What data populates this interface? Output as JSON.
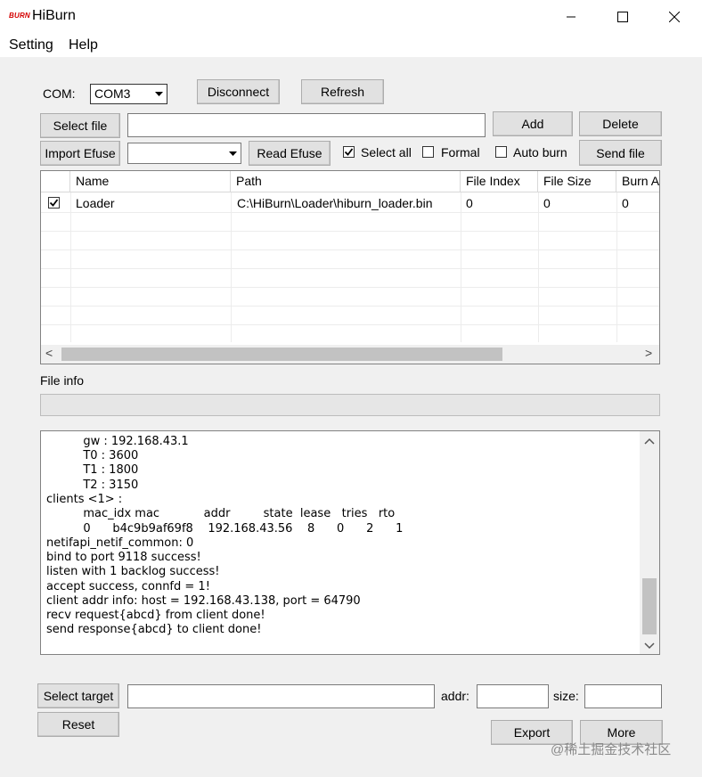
{
  "window": {
    "logo_text": "BURN",
    "title": "HiBurn",
    "minimize_glyph": "—",
    "close_glyph": "✕"
  },
  "menu": {
    "items": [
      "Setting",
      "Help"
    ]
  },
  "com": {
    "label": "COM:",
    "selected": "COM3",
    "disconnect_label": "Disconnect",
    "refresh_label": "Refresh"
  },
  "file_row": {
    "select_file_label": "Select file",
    "path_value": "",
    "add_label": "Add",
    "delete_label": "Delete"
  },
  "efuse_row": {
    "import_efuse_label": "Import Efuse",
    "efuse_selected": "",
    "read_efuse_label": "Read Efuse",
    "select_all_label": "Select all",
    "select_all_checked": true,
    "formal_label": "Formal",
    "formal_checked": false,
    "auto_burn_label": "Auto burn",
    "auto_burn_checked": false,
    "send_file_label": "Send file"
  },
  "table": {
    "columns": [
      "Name",
      "Path",
      "File Index",
      "File Size",
      "Burn A"
    ],
    "rows": [
      {
        "checked": true,
        "name": "Loader",
        "path": "C:\\HiBurn\\Loader\\hiburn_loader.bin",
        "file_index": "0",
        "file_size": "0",
        "burn_a": "0"
      }
    ],
    "hscroll_left": "<",
    "hscroll_right": ">"
  },
  "file_info": {
    "label": "File info",
    "progress": 0
  },
  "log": {
    "lines": [
      "          gw : 192.168.43.1",
      "          T0 : 3600",
      "          T1 : 1800",
      "          T2 : 3150",
      "clients <1> :",
      "          mac_idx mac            addr         state  lease   tries   rto",
      "          0      b4c9b9af69f8    192.168.43.56    8      0      2      1",
      "netifapi_netif_common: 0",
      "bind to port 9118 success!",
      "listen with 1 backlog success!",
      "accept success, connfd = 1!",
      "client addr info: host = 192.168.43.138, port = 64790",
      "recv request{abcd} from client done!",
      "send response{abcd} to client done!"
    ],
    "scroll_up": "︿",
    "scroll_down": "﹀"
  },
  "bottom": {
    "select_target_label": "Select target",
    "target_value": "",
    "addr_label": "addr:",
    "addr_value": "",
    "size_label": "size:",
    "size_value": "",
    "reset_label": "Reset",
    "export_label": "Export",
    "more_label": "More"
  },
  "watermark": "@稀土掘金技术社区"
}
